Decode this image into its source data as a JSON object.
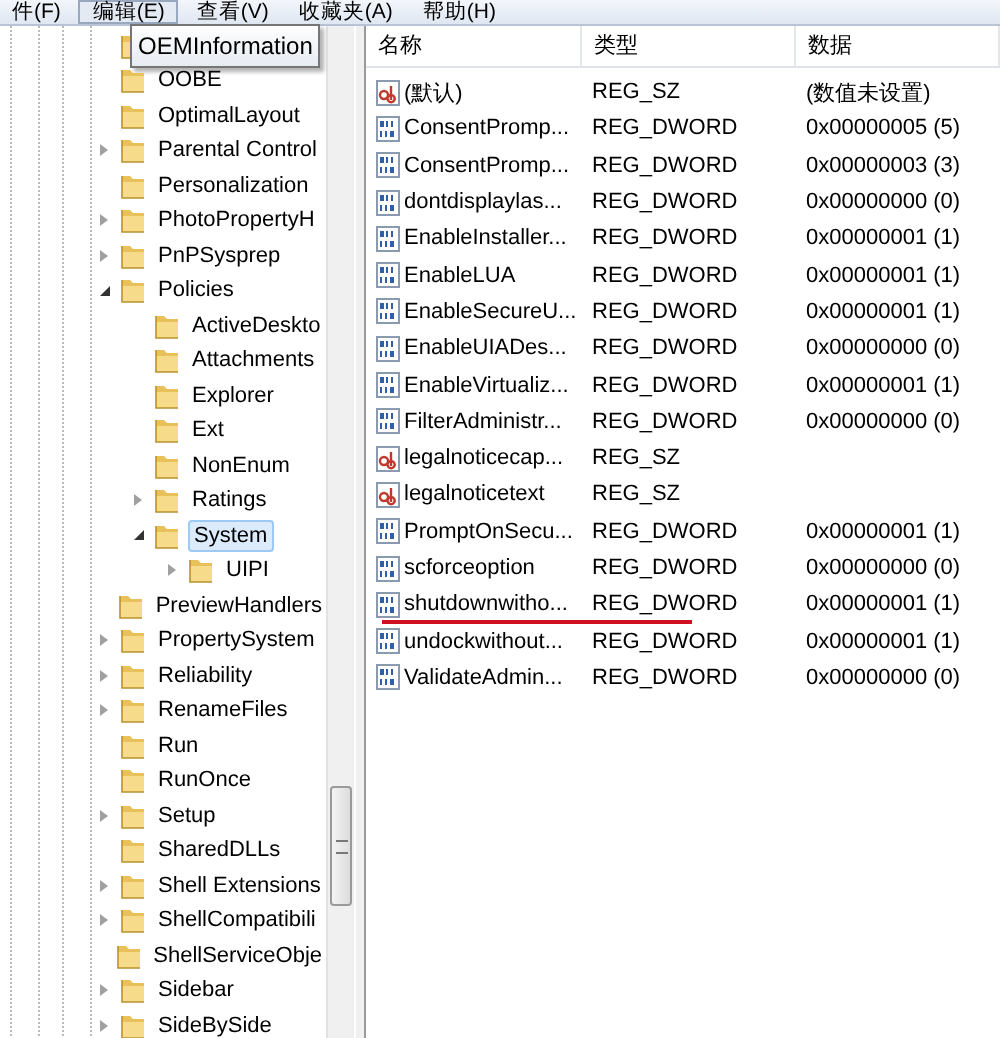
{
  "menu": [
    {
      "label": "件(F)",
      "selected": false
    },
    {
      "label": "编辑(E)",
      "selected": true
    },
    {
      "label": "查看(V)",
      "selected": false
    },
    {
      "label": "收藏夹(A)",
      "selected": false
    },
    {
      "label": "帮助(H)",
      "selected": false
    }
  ],
  "tree": [
    {
      "label": "OEMInformation",
      "tooltip": true,
      "selected": false
    },
    {
      "label": "OOBE",
      "tooltip": false,
      "selected": false
    },
    {
      "label": "OptimalLayout",
      "tooltip": false,
      "selected": false
    },
    {
      "label": "Parental Control",
      "tooltip": false,
      "expanded": false,
      "selected": false
    },
    {
      "label": "Personalization",
      "tooltip": false,
      "selected": false
    },
    {
      "label": "PhotoPropertyH",
      "tooltip": false,
      "expanded": false,
      "selected": false
    },
    {
      "label": "PnPSysprep",
      "tooltip": false,
      "expanded": false,
      "selected": false
    },
    {
      "label": "Policies",
      "tooltip": false,
      "expanded": true,
      "selected": false,
      "children": [
        {
          "label": "ActiveDeskto",
          "tooltip": false,
          "selected": false
        },
        {
          "label": "Attachments",
          "tooltip": false,
          "selected": false
        },
        {
          "label": "Explorer",
          "tooltip": false,
          "selected": false
        },
        {
          "label": "Ext",
          "tooltip": false,
          "selected": false
        },
        {
          "label": "NonEnum",
          "tooltip": false,
          "selected": false
        },
        {
          "label": "Ratings",
          "tooltip": false,
          "expanded": false,
          "selected": false
        },
        {
          "label": "System",
          "tooltip": false,
          "expanded": true,
          "selected": true,
          "children": [
            {
              "label": "UIPI",
              "tooltip": false,
              "expanded": false,
              "selected": false
            }
          ]
        }
      ]
    },
    {
      "label": "PreviewHandlers",
      "tooltip": false,
      "selected": false
    },
    {
      "label": "PropertySystem",
      "tooltip": false,
      "expanded": false,
      "selected": false
    },
    {
      "label": "Reliability",
      "tooltip": false,
      "expanded": false,
      "selected": false
    },
    {
      "label": "RenameFiles",
      "tooltip": false,
      "expanded": false,
      "selected": false
    },
    {
      "label": "Run",
      "tooltip": false,
      "selected": false
    },
    {
      "label": "RunOnce",
      "tooltip": false,
      "selected": false
    },
    {
      "label": "Setup",
      "tooltip": false,
      "expanded": false,
      "selected": false
    },
    {
      "label": "SharedDLLs",
      "tooltip": false,
      "selected": false
    },
    {
      "label": "Shell Extensions",
      "tooltip": false,
      "expanded": false,
      "selected": false
    },
    {
      "label": "ShellCompatibili",
      "tooltip": false,
      "expanded": false,
      "selected": false
    },
    {
      "label": "ShellServiceObje",
      "tooltip": false,
      "selected": false
    },
    {
      "label": "Sidebar",
      "tooltip": false,
      "expanded": false,
      "selected": false
    },
    {
      "label": "SideBySide",
      "tooltip": false,
      "expanded": false,
      "selected": false
    }
  ],
  "values": {
    "columns": [
      "名称",
      "类型",
      "数据"
    ],
    "rows": [
      {
        "kind": "string",
        "name": "(默认)",
        "type": "REG_SZ",
        "data": "(数值未设置)",
        "underlined": false
      },
      {
        "kind": "binary",
        "name": "ConsentPromp...",
        "type": "REG_DWORD",
        "data": "0x00000005 (5)",
        "underlined": false
      },
      {
        "kind": "binary",
        "name": "ConsentPromp...",
        "type": "REG_DWORD",
        "data": "0x00000003 (3)",
        "underlined": false
      },
      {
        "kind": "binary",
        "name": "dontdisplaylas...",
        "type": "REG_DWORD",
        "data": "0x00000000 (0)",
        "underlined": false
      },
      {
        "kind": "binary",
        "name": "EnableInstaller...",
        "type": "REG_DWORD",
        "data": "0x00000001 (1)",
        "underlined": false
      },
      {
        "kind": "binary",
        "name": "EnableLUA",
        "type": "REG_DWORD",
        "data": "0x00000001 (1)",
        "underlined": false
      },
      {
        "kind": "binary",
        "name": "EnableSecureU...",
        "type": "REG_DWORD",
        "data": "0x00000001 (1)",
        "underlined": false
      },
      {
        "kind": "binary",
        "name": "EnableUIADes...",
        "type": "REG_DWORD",
        "data": "0x00000000 (0)",
        "underlined": false
      },
      {
        "kind": "binary",
        "name": "EnableVirtualiz...",
        "type": "REG_DWORD",
        "data": "0x00000001 (1)",
        "underlined": false
      },
      {
        "kind": "binary",
        "name": "FilterAdministr...",
        "type": "REG_DWORD",
        "data": "0x00000000 (0)",
        "underlined": false
      },
      {
        "kind": "string",
        "name": "legalnoticecap...",
        "type": "REG_SZ",
        "underlined": false
      },
      {
        "kind": "string",
        "name": "legalnoticetext",
        "type": "REG_SZ",
        "underlined": false
      },
      {
        "kind": "binary",
        "name": "PromptOnSecu...",
        "type": "REG_DWORD",
        "data": "0x00000001 (1)",
        "underlined": false
      },
      {
        "kind": "binary",
        "name": "scforceoption",
        "type": "REG_DWORD",
        "data": "0x00000000 (0)",
        "underlined": false
      },
      {
        "kind": "binary",
        "name": "shutdownwitho...",
        "type": "REG_DWORD",
        "data": "0x00000001 (1)",
        "underlined": true
      },
      {
        "kind": "binary",
        "name": "undockwithout...",
        "type": "REG_DWORD",
        "data": "0x00000001 (1)",
        "underlined": false
      },
      {
        "kind": "binary",
        "name": "ValidateAdmin...",
        "type": "REG_DWORD",
        "data": "0x00000000 (0)",
        "underlined": false
      }
    ]
  }
}
